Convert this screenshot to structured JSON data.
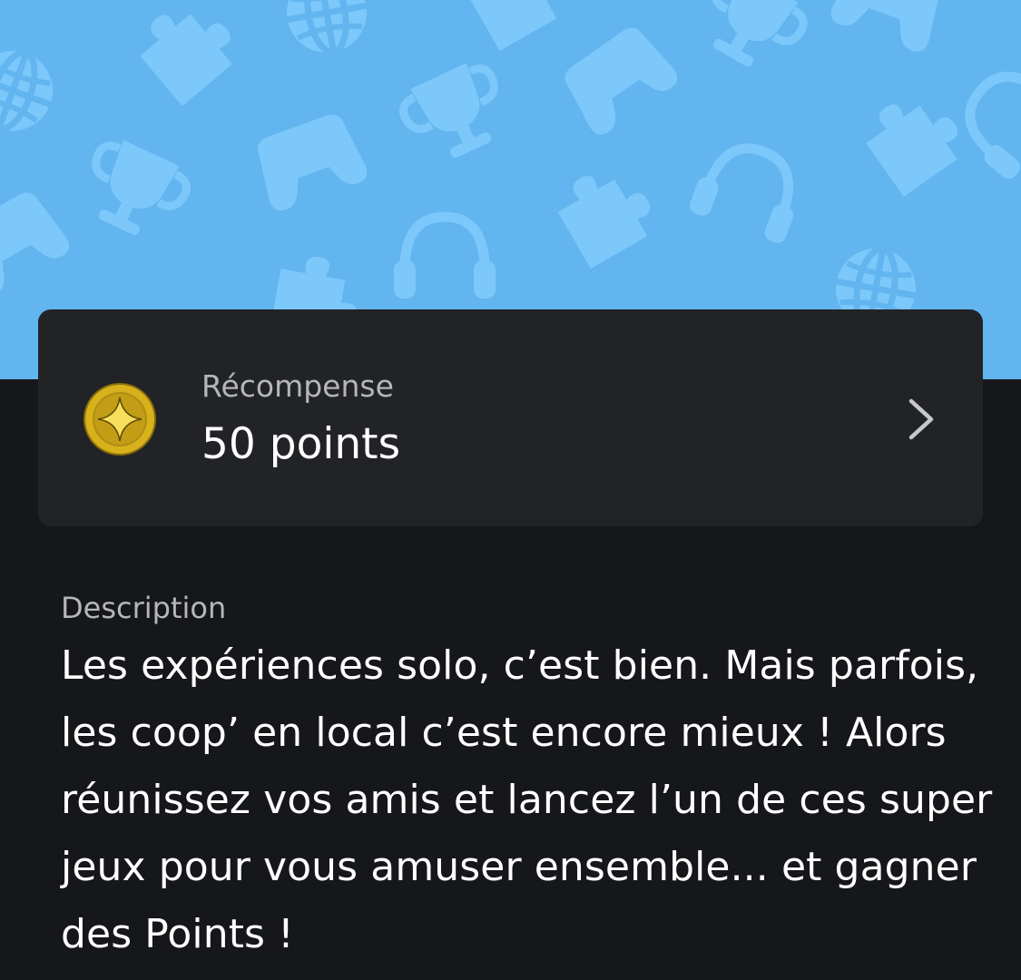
{
  "colors": {
    "banner_bg": "#63b5ef",
    "banner_pattern": "#7cc8fb",
    "page_bg": "#16171a",
    "card_bg": "#222326",
    "coin_gold": "#c9a416",
    "coin_star": "#f4d84a"
  },
  "icons": {
    "banner_pattern": [
      "trophy-icon",
      "gamepad-icon",
      "headset-icon",
      "globe-icon",
      "puzzle-icon"
    ],
    "reward": "gold-star-coin-icon",
    "chevron": "chevron-right-icon"
  },
  "reward": {
    "label": "Récompense",
    "value": "50 points"
  },
  "description": {
    "label": "Description",
    "text": "Les expériences solo, c’est bien. Mais parfois, les coop’ en local c’est encore mieux ! Alors réunissez vos amis et lancez l’un de ces super jeux pour vous amuser ensemble... et gagner des Points !"
  }
}
